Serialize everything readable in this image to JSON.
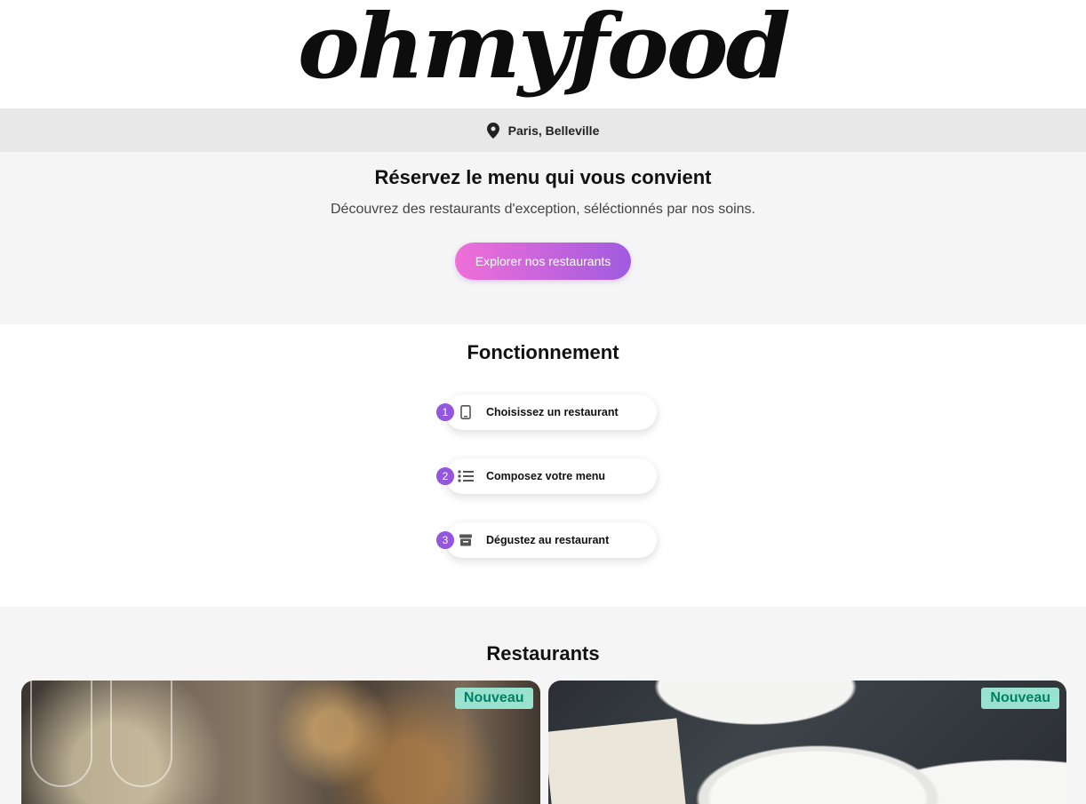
{
  "brand": {
    "logo_text": "ohmyfood"
  },
  "location": {
    "text": "Paris, Belleville",
    "icon": "map-pin-icon"
  },
  "hero": {
    "title": "Réservez le menu qui vous convient",
    "subtitle": "Découvrez des restaurants d'exception, séléctionnés par nos soins.",
    "cta_label": "Explorer nos restaurants"
  },
  "how": {
    "title": "Fonctionnement",
    "steps": [
      {
        "number": "1",
        "icon": "mobile-phone-icon",
        "label": "Choisissez un restaurant"
      },
      {
        "number": "2",
        "icon": "list-icon",
        "label": "Composez votre menu"
      },
      {
        "number": "3",
        "icon": "store-icon",
        "label": "Dégustez au restaurant"
      }
    ]
  },
  "restaurants": {
    "title": "Restaurants",
    "cards": [
      {
        "badge": "Nouveau"
      },
      {
        "badge": "Nouveau"
      }
    ]
  },
  "colors": {
    "accent_start": "#f06fd8",
    "accent_end": "#a05be0",
    "badge_bg": "#99e2d0",
    "badge_text": "#008262"
  }
}
